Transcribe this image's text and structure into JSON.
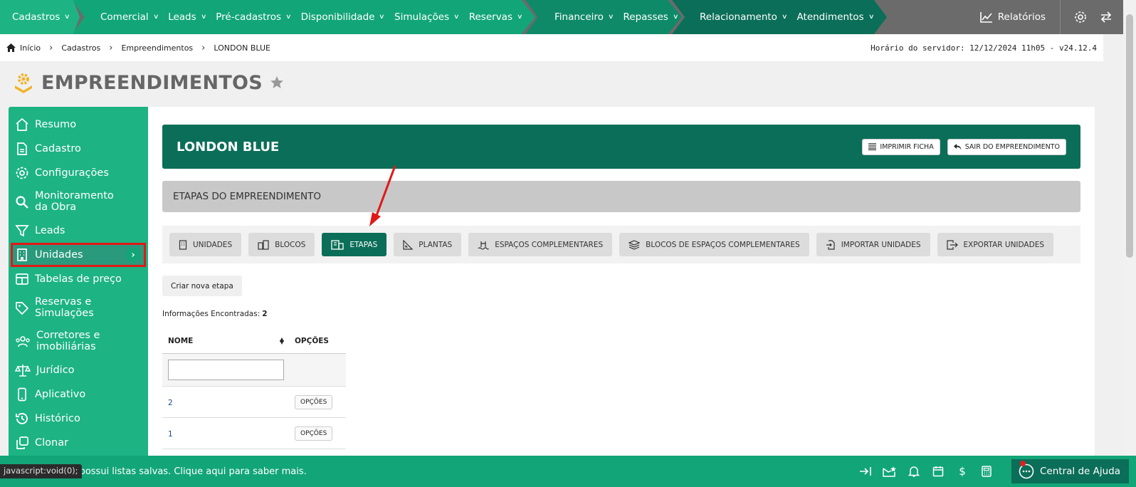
{
  "topnav": {
    "group1": [
      "Cadastros"
    ],
    "group2": [
      "Comercial",
      "Leads",
      "Pré-cadastros",
      "Disponibilidade",
      "Simulações",
      "Reservas"
    ],
    "group3": [
      "Financeiro",
      "Repasses"
    ],
    "group4": [
      "Relacionamento",
      "Atendimentos"
    ],
    "reports": "Relatórios"
  },
  "breadcrumb": {
    "items": [
      "Início",
      "Cadastros",
      "Empreendimentos",
      "LONDON BLUE"
    ],
    "server_time": "Horário do servidor: 12/12/2024 11h05 - v24.12.4"
  },
  "page": {
    "title": "EMPREENDIMENTOS"
  },
  "sidebar": {
    "items": [
      {
        "label": "Resumo",
        "icon": "home-icon"
      },
      {
        "label": "Cadastro",
        "icon": "document-icon"
      },
      {
        "label": "Configurações",
        "icon": "gear-icon"
      },
      {
        "label": "Monitoramento da Obra",
        "icon": "search-icon"
      },
      {
        "label": "Leads",
        "icon": "filter-icon"
      },
      {
        "label": "Unidades",
        "icon": "building-icon"
      },
      {
        "label": "Tabelas de preço",
        "icon": "table-icon"
      },
      {
        "label": "Reservas e Simulações",
        "icon": "tag-icon"
      },
      {
        "label": "Corretores e imobiliárias",
        "icon": "users-icon"
      },
      {
        "label": "Jurídico",
        "icon": "scale-icon"
      },
      {
        "label": "Aplicativo",
        "icon": "phone-icon"
      },
      {
        "label": "Histórico",
        "icon": "history-icon"
      },
      {
        "label": "Clonar",
        "icon": "clone-icon"
      }
    ]
  },
  "project": {
    "name": "LONDON BLUE",
    "print_label": "IMPRIMIR FICHA",
    "exit_label": "SAIR DO EMPREENDIMENTO"
  },
  "section": {
    "title": "ETAPAS DO EMPREENDIMENTO"
  },
  "tabs": [
    {
      "label": "UNIDADES",
      "active": false
    },
    {
      "label": "BLOCOS",
      "active": false
    },
    {
      "label": "ETAPAS",
      "active": true
    },
    {
      "label": "PLANTAS",
      "active": false
    },
    {
      "label": "ESPAÇOS COMPLEMENTARES",
      "active": false
    },
    {
      "label": "BLOCOS DE ESPAÇOS COMPLEMENTARES",
      "active": false
    },
    {
      "label": "IMPORTAR UNIDADES",
      "active": false
    },
    {
      "label": "EXPORTAR UNIDADES",
      "active": false
    }
  ],
  "actions": {
    "create_label": "Criar nova etapa"
  },
  "results": {
    "label": "Informações Encontradas:",
    "count": "2"
  },
  "table": {
    "columns": [
      "NOME",
      "OPÇÕES"
    ],
    "rows": [
      {
        "nome": "2",
        "options_label": "OPÇÕES"
      },
      {
        "nome": "1",
        "options_label": "OPÇÕES"
      }
    ]
  },
  "bottom": {
    "message": "Você ainda não possui listas salvas. Clique aqui para saber mais.",
    "status_url": "javascript:void(0);",
    "help_label": "Central de Ajuda"
  },
  "colors": {
    "brand": "#1db383",
    "dark": "#0b6e58",
    "highlight": "#e01818"
  }
}
